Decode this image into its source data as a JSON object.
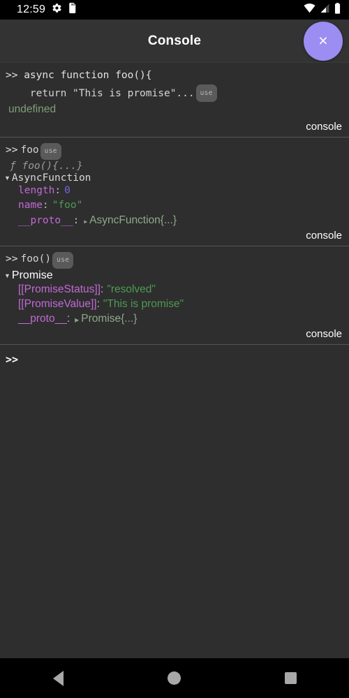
{
  "status_bar": {
    "time": "12:59",
    "icons_left": [
      "gear-icon",
      "sd-card-icon"
    ],
    "icons_right": [
      "wifi-icon",
      "cellular-signal-icon",
      "battery-icon"
    ]
  },
  "header": {
    "title": "Console",
    "close_label": "×",
    "close_color": "#9b8df2"
  },
  "console": {
    "badge_label": "use",
    "source_label": "console",
    "prompt": ">>",
    "entries": [
      {
        "id": "entry-async-function",
        "command_lines": [
          ">> async function foo(){",
          "    return \"This is promise\"..."
        ],
        "result_type": "simple",
        "result_text": "undefined",
        "source": "console"
      },
      {
        "id": "entry-foo",
        "command": "foo",
        "signature": "ƒ foo(){...}",
        "result_type": "tree",
        "tree_title": "AsyncFunction",
        "tree_font": "mono",
        "properties": [
          {
            "key": "length",
            "value": "0",
            "value_type": "number"
          },
          {
            "key": "name",
            "value": "\"foo\"",
            "value_type": "string"
          },
          {
            "key": "__proto__",
            "value": "AsyncFunction{...}",
            "value_type": "object"
          }
        ],
        "source": "console"
      },
      {
        "id": "entry-foo-call",
        "command": "foo()",
        "result_type": "tree",
        "tree_title": "Promise",
        "tree_font": "sans",
        "properties": [
          {
            "key": "[[PromiseStatus]]",
            "value": "\"resolved\"",
            "value_type": "string"
          },
          {
            "key": "[[PromiseValue]]",
            "value": "\"This is promise\"",
            "value_type": "string"
          },
          {
            "key": "__proto__",
            "value": "Promise{...}",
            "value_type": "object"
          }
        ],
        "source": "console"
      }
    ],
    "input": {
      "prompt": ">>",
      "value": "",
      "placeholder": ""
    }
  },
  "nav_bar": {
    "items": [
      {
        "name": "back-button",
        "icon": "back-triangle-icon"
      },
      {
        "name": "home-button",
        "icon": "home-circle-icon"
      },
      {
        "name": "recents-button",
        "icon": "recents-square-icon"
      }
    ]
  }
}
